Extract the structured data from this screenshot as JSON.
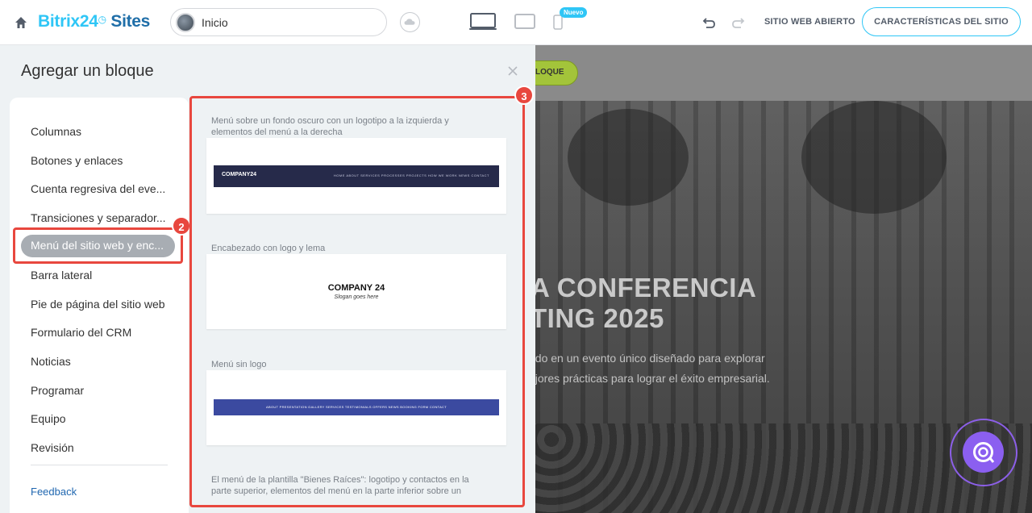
{
  "header": {
    "brand_main": "Bitrix24",
    "brand_sites": "Sites",
    "page_select_label": "Inicio",
    "nuevo_badge": "Nuevo",
    "open_site_label": "SITIO WEB ABIERTO",
    "features_label": "CARACTERÍSTICAS DEL SITIO"
  },
  "panel": {
    "title": "Agregar un bloque",
    "sidebar_items": [
      "Columnas",
      "Botones y enlaces",
      "Cuenta regresiva del eve...",
      "Transiciones y separador...",
      "Menú del sitio web y enc...",
      "Barra lateral",
      "Pie de página del sitio web",
      "Formulario del CRM",
      "Noticias",
      "Programar",
      "Equipo",
      "Revisión"
    ],
    "active_index": 4,
    "feedback": "Feedback",
    "callouts": [
      "2",
      "3"
    ]
  },
  "blocks": [
    {
      "description": "Menú sobre un fondo oscuro con un logotipo a la izquierda y elementos del menú a la derecha",
      "logo": "COMPANY24",
      "nav": "HOME   ABOUT   SERVICES   PROCESSES   PROJECTS   HOW WE WORK   NEWS   CONTACT"
    },
    {
      "description": "Encabezado con logo y lema",
      "logo": "COMPANY 24",
      "slogan": "Slogan goes here"
    },
    {
      "description": "Menú sin logo",
      "nav": "ABOUT   PRESENTATION   GALLERY   SERVICES   TESTIMONIALS   OFFERS   NEWS   BOOKING FORM   CONTACT"
    },
    {
      "description": "El menú de la plantilla \"Bienes Raíces\": logotipo y contactos en la parte superior, elementos del menú en la parte inferior sobre un"
    }
  ],
  "preview": {
    "add_block_button": "LOQUE",
    "hero_title": "A CONFERENCIA\nTING 2025",
    "hero_text": "ndo en un evento único diseñado para explorar\nejores prácticas para lograr el éxito empresarial."
  },
  "colors": {
    "accent": "#2fc6f6",
    "brand_dark": "#1f6ea8",
    "callout": "#e8473e",
    "chat": "#8b5ff0"
  }
}
